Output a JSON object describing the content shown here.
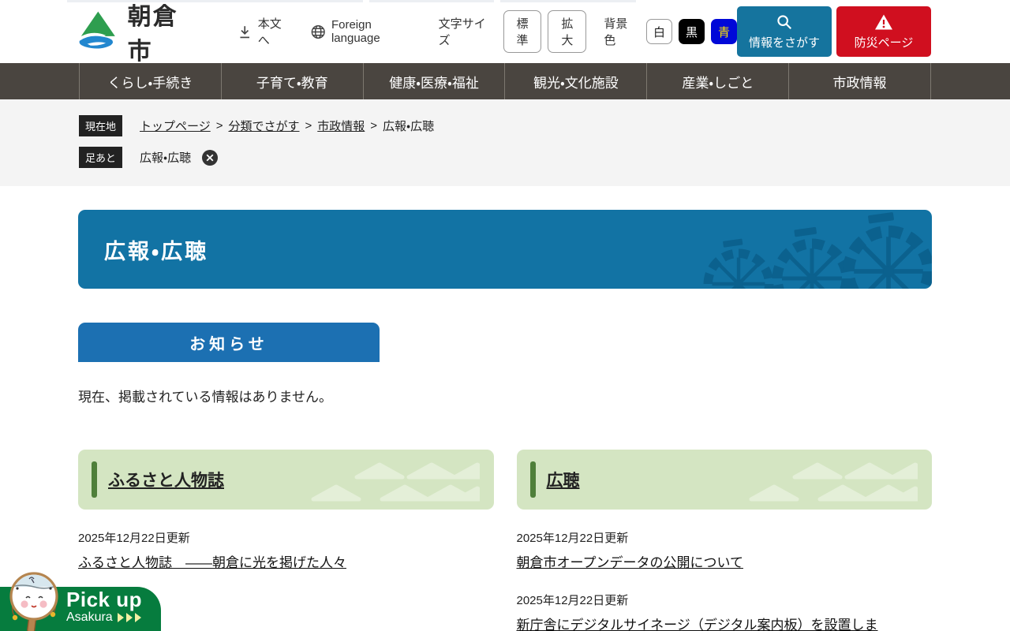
{
  "colors": {
    "banner_blue": "#1273a4",
    "wheel_blue": "#0b618e",
    "notice_blue": "#1c70b2",
    "nav_dark": "#4a4540",
    "accent_green": "#4f7f3a",
    "card_green": "#d4e5c2",
    "pattern_green": "#e4efd8",
    "pickup_green": "#067c3e",
    "search_blue": "#15749e",
    "emergency_red": "#d00f1f",
    "bg_blue_button": "#0008d8"
  },
  "header": {
    "site_name": "朝倉市",
    "skip_link": "本文へ",
    "foreign_language": "Foreign language",
    "font_size": {
      "label": "文字サイズ",
      "options": [
        "標準",
        "拡大"
      ]
    },
    "bg_color": {
      "label": "背景色",
      "options": [
        "白",
        "黒",
        "青"
      ]
    },
    "search_button": "情報をさがす",
    "emergency_button": "防災ページ"
  },
  "global_nav": {
    "items": [
      "くらし・手続き",
      "子育て・教育",
      "健康・医療・福祉",
      "観光・文化施設",
      "産業・しごと",
      "市政情報"
    ]
  },
  "breadcrumb": {
    "location_label": "現在地",
    "separator": ">",
    "links": [
      "トップページ",
      "分類でさがす",
      "市政情報"
    ],
    "current": "広報・広聴",
    "footprint_label": "足あと",
    "footprint_item": "広報・広聴"
  },
  "page": {
    "title": "広報・広聴",
    "notice_heading": "お知らせ",
    "notice_empty": "現在、掲載されている情報はありません。",
    "sections": [
      {
        "title": "ふるさと人物誌",
        "items": [
          {
            "date": "2025年12月22日更新",
            "title": "ふるさと人物誌　——朝倉に光を掲げた人々"
          }
        ]
      },
      {
        "title": "広聴",
        "items": [
          {
            "date": "2025年12月22日更新",
            "title": "朝倉市オープンデータの公開について"
          },
          {
            "date": "2025年12月22日更新",
            "title": "新庁舎にデジタルサイネージ（デジタル案内板）を設置しま"
          }
        ]
      }
    ]
  },
  "pickup": {
    "line1": "Pick up",
    "line2": "Asakura"
  }
}
